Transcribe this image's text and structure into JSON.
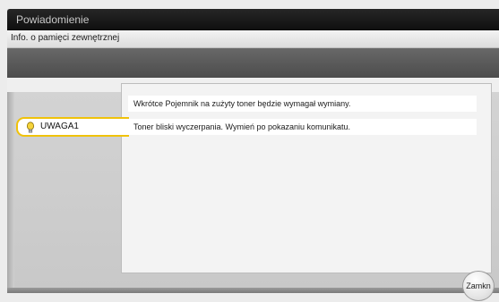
{
  "window": {
    "title": "Powiadomienie",
    "subtitle": "Info. o pamięci zewnętrznej"
  },
  "tab": {
    "label": "UWAGA1",
    "icon": "lightbulb-icon",
    "accent_color": "#f0c20a"
  },
  "messages": [
    "Wkrótce Pojemnik na zużyty toner będzie wymagał wymiany.",
    "Toner bliski wyczerpania. Wymień po pokazaniu komunikatu."
  ],
  "close_button": {
    "label": "Zamkn"
  }
}
